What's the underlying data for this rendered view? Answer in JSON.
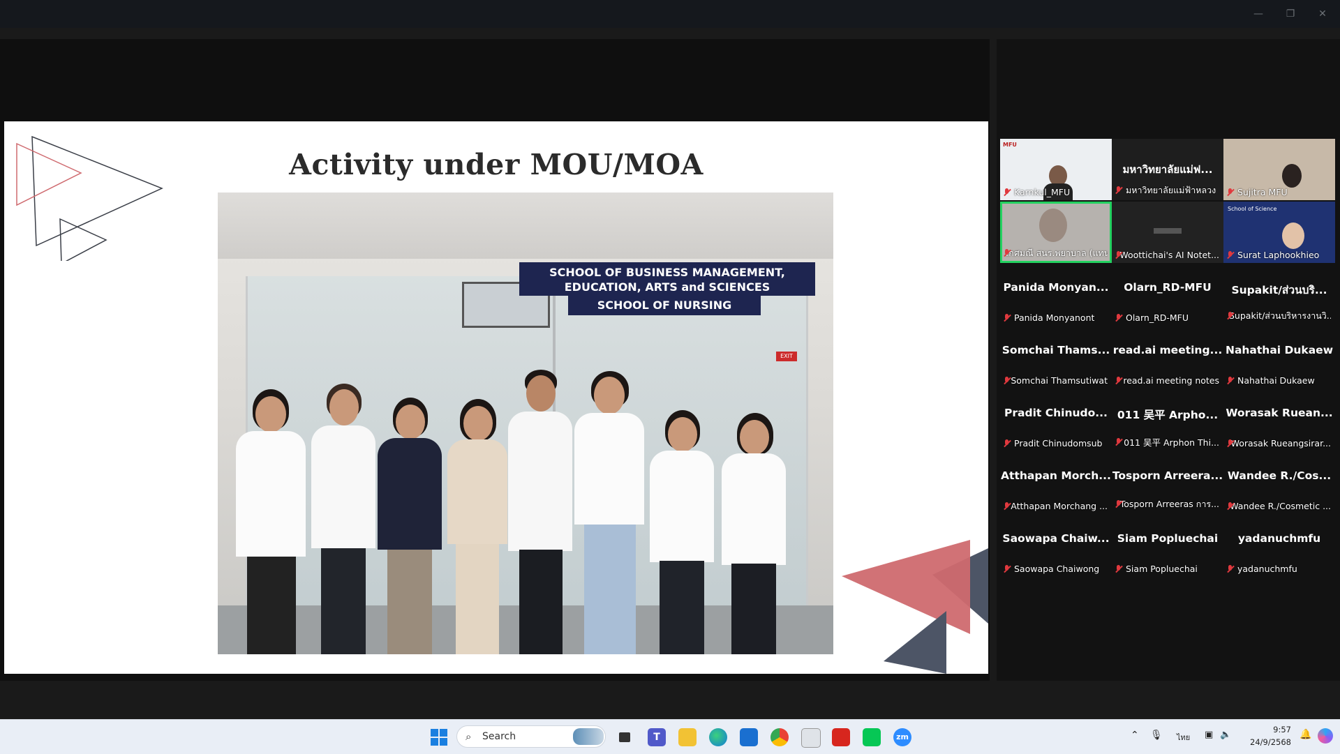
{
  "window": {
    "controls": [
      "minimize",
      "restore",
      "close"
    ]
  },
  "slide": {
    "title": "Activity under MOU/MOA",
    "sign_line1": "SCHOOL OF BUSINESS MANAGEMENT,",
    "sign_line2": "EDUCATION, ARTS and SCIENCES",
    "sign_line3": "SCHOOL OF NURSING",
    "exit_sign": "EXIT"
  },
  "gallery": {
    "video_tiles": [
      {
        "name": "Karnkul_MFU",
        "logo": "MFU"
      },
      {
        "big": "มหาวิทยาลัยแม่ฟ...",
        "name": "มหาวิทยาลัยแม่ฟ้าหลวง"
      },
      {
        "name": "Sujitra MFU"
      },
      {
        "name": "เกศมณี สนร.พยาบาล (แทน)",
        "active": true
      },
      {
        "name": "Woottichai's AI Notet..."
      },
      {
        "name": "Surat Laphookhieo",
        "banner": "School of Science"
      }
    ],
    "participants": [
      {
        "big": "Panida  Monyan...",
        "name": "Panida Monyanont"
      },
      {
        "big": "Olarn_RD-MFU",
        "name": "Olarn_RD-MFU"
      },
      {
        "big": "Supakit/ส่วนบริ...",
        "name": "Supakit/ส่วนบริหารงานวิ..."
      },
      {
        "big": "Somchai  Thams...",
        "name": "Somchai Thamsutiwat"
      },
      {
        "big": "read.ai  meeting...",
        "name": "read.ai meeting notes"
      },
      {
        "big": "Nahathai Dukaew",
        "name": "Nahathai Dukaew"
      },
      {
        "big": "Pradit  Chinudo...",
        "name": "Pradit Chinudomsub"
      },
      {
        "big": "011 吴平  Arpho...",
        "name": "011 吴平 Arphon Thi..."
      },
      {
        "big": "Worasak  Ruean...",
        "name": "Worasak Rueangsirar..."
      },
      {
        "big": "Atthapan  Morch...",
        "name": "Atthapan Morchang ..."
      },
      {
        "big": "Tosporn  Arreera...",
        "name": "Tosporn Arreeras การ..."
      },
      {
        "big": "Wandee  R./Cos...",
        "name": "Wandee R./Cosmetic ..."
      },
      {
        "big": "Saowapa  Chaiw...",
        "name": "Saowapa Chaiwong"
      },
      {
        "big": "Siam Popluechai",
        "name": "Siam Popluechai"
      },
      {
        "big": "yadanuchmfu",
        "name": "yadanuchmfu"
      }
    ]
  },
  "taskbar": {
    "search_placeholder": "Search",
    "time": "9:57",
    "date": "24/9/2568",
    "lang": "ไทย",
    "apps": [
      "start-icon",
      "search-icon",
      "widgets-icon",
      "task-view-icon",
      "teams-icon",
      "file-explorer-icon",
      "edge-icon",
      "store-icon",
      "chrome-icon",
      "folder-icon",
      "acrobat-icon",
      "line-icon",
      "zoom-icon"
    ]
  },
  "colors": {
    "accent_green": "#23d160",
    "mic_red": "#e0393e",
    "sign_navy": "#1e2550",
    "triangle_red": "#cf6a6f",
    "triangle_slate": "#4d5566"
  }
}
